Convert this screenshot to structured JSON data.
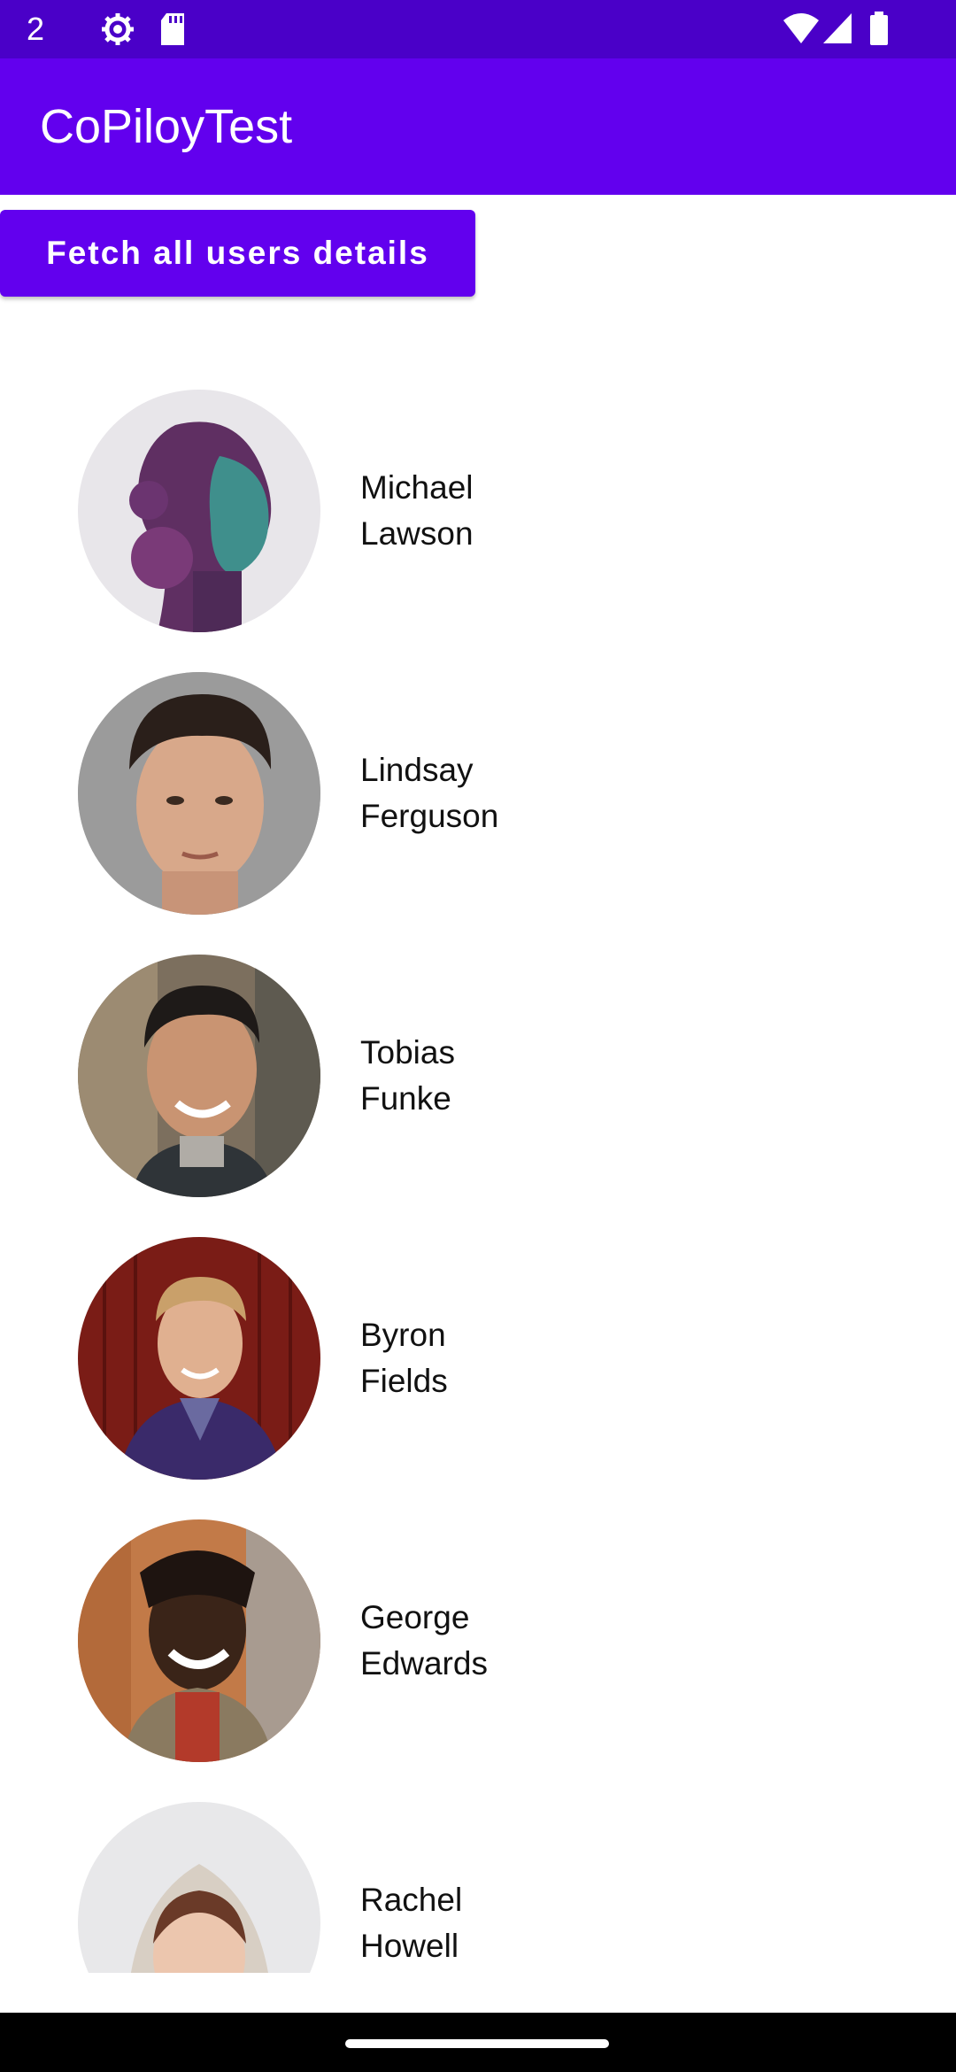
{
  "status_bar": {
    "time": "2",
    "icons": [
      "gear-icon",
      "sd-card-icon",
      "wifi-icon",
      "signal-icon",
      "battery-icon"
    ],
    "color": "#4a00c8"
  },
  "app_bar": {
    "title": "CoPiloyTest",
    "color": "#6200ee"
  },
  "fetch_button": {
    "label": "Fetch all users details",
    "color": "#6200ee"
  },
  "users": [
    {
      "first": "Michael",
      "last": "Lawson"
    },
    {
      "first": "Lindsay",
      "last": "Ferguson"
    },
    {
      "first": "Tobias",
      "last": "Funke"
    },
    {
      "first": "Byron",
      "last": "Fields"
    },
    {
      "first": "George",
      "last": "Edwards"
    },
    {
      "first": "Rachel",
      "last": "Howell"
    }
  ]
}
